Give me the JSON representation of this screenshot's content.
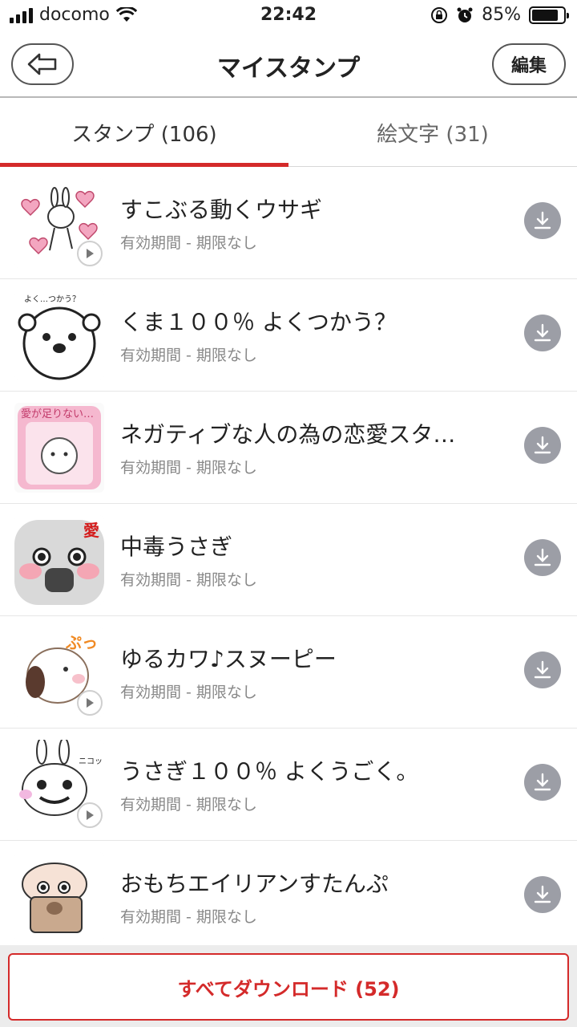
{
  "status_bar": {
    "carrier": "docomo",
    "time": "22:42",
    "battery_percent": "85%",
    "battery_level": 0.85
  },
  "header": {
    "title": "マイスタンプ",
    "edit_label": "編集"
  },
  "tabs": [
    {
      "label": "スタンプ (106)",
      "active": true
    },
    {
      "label": "絵文字 (31)",
      "active": false
    }
  ],
  "stickers": [
    {
      "title": "すこぶる動くウサギ",
      "subtitle": "有効期間 - 期限なし",
      "animated": true,
      "thumb_color": "#f7c8d6"
    },
    {
      "title": "くま１００％ よくつかう？",
      "subtitle": "有効期間 - 期限なし",
      "animated": false,
      "thumb_color": "#eeeeee"
    },
    {
      "title": "ネガティブな人の為の恋愛スタ…",
      "subtitle": "有効期間 - 期限なし",
      "animated": false,
      "thumb_color": "#f5b8cf"
    },
    {
      "title": "中毒うさぎ",
      "subtitle": "有効期間 - 期限なし",
      "animated": false,
      "thumb_color": "#d9d9d9"
    },
    {
      "title": "ゆるカワ♪スヌーピー",
      "subtitle": "有効期間 - 期限なし",
      "animated": true,
      "thumb_color": "#f3efe8"
    },
    {
      "title": "うさぎ１００％ よくうごく。",
      "subtitle": "有効期間 - 期限なし",
      "animated": true,
      "thumb_color": "#f0f0f0"
    },
    {
      "title": "おもちエイリアンすたんぷ",
      "subtitle": "有効期間 - 期限なし",
      "animated": false,
      "thumb_color": "#ecd9c7"
    }
  ],
  "footer": {
    "download_all_label": "すべてダウンロード (52)"
  },
  "colors": {
    "accent": "#d42a2a",
    "download_icon_bg": "#9c9ea6"
  }
}
